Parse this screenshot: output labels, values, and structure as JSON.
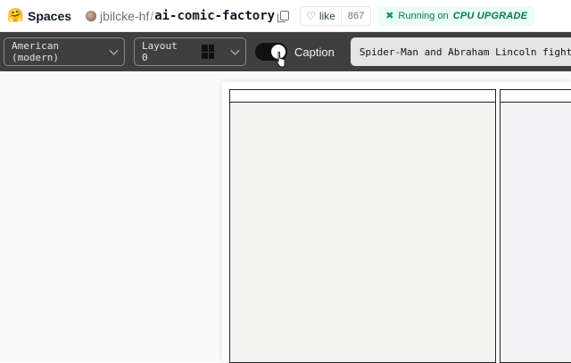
{
  "header": {
    "brand": "Spaces",
    "owner": "jbilcke-hf",
    "separator": "/",
    "repo": "ai-comic-factory",
    "like_label": "like",
    "like_count": "867",
    "status_prefix": "Running on",
    "status_hw": "CPU UPGRADE"
  },
  "toolbar": {
    "style_select": "American (modern)",
    "layout_select": "Layout 0",
    "caption_label": "Caption",
    "caption_enabled": true,
    "prompt_value": "Spider-Man and Abraham Lincoln fighting"
  },
  "colors": {
    "toolbar_bg": "#3f3f3f",
    "status_green": "#047857",
    "panel_fill": "#f3f3f0"
  },
  "icons": [
    "hugging-face-logo",
    "copy-icon",
    "heart-icon",
    "sparkle-icon",
    "chevron-down-icon",
    "layout-grid-icon",
    "toggle-switch",
    "pointer-cursor"
  ]
}
